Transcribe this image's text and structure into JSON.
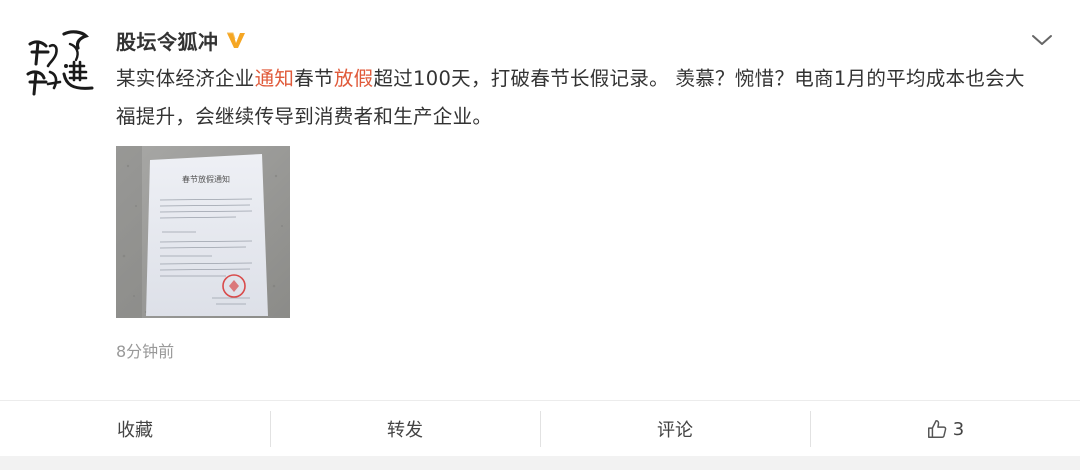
{
  "author": {
    "name": "股坛令狐冲",
    "verified_icon": "verified-v-icon"
  },
  "avatar": {
    "calligraphy": [
      "飞",
      "道",
      "断",
      "鹏"
    ]
  },
  "post": {
    "segments": [
      {
        "text": "某实体经济企业",
        "highlight": false
      },
      {
        "text": "通知",
        "highlight": true
      },
      {
        "text": "春节",
        "highlight": false
      },
      {
        "text": "放假",
        "highlight": true
      },
      {
        "text": "超过100天，打破春节长假记录。 羡慕？惋惜？电商1月的平均成本也会大福提升，会继续传导到消费者和生产企业。",
        "highlight": false
      }
    ],
    "highlight_color": "#e05a3a"
  },
  "image": {
    "notice_title": "春节放假通知"
  },
  "timestamp": "8分钟前",
  "actions": {
    "favorite": "收藏",
    "repost": "转发",
    "comment": "评论",
    "like_count": "3"
  }
}
